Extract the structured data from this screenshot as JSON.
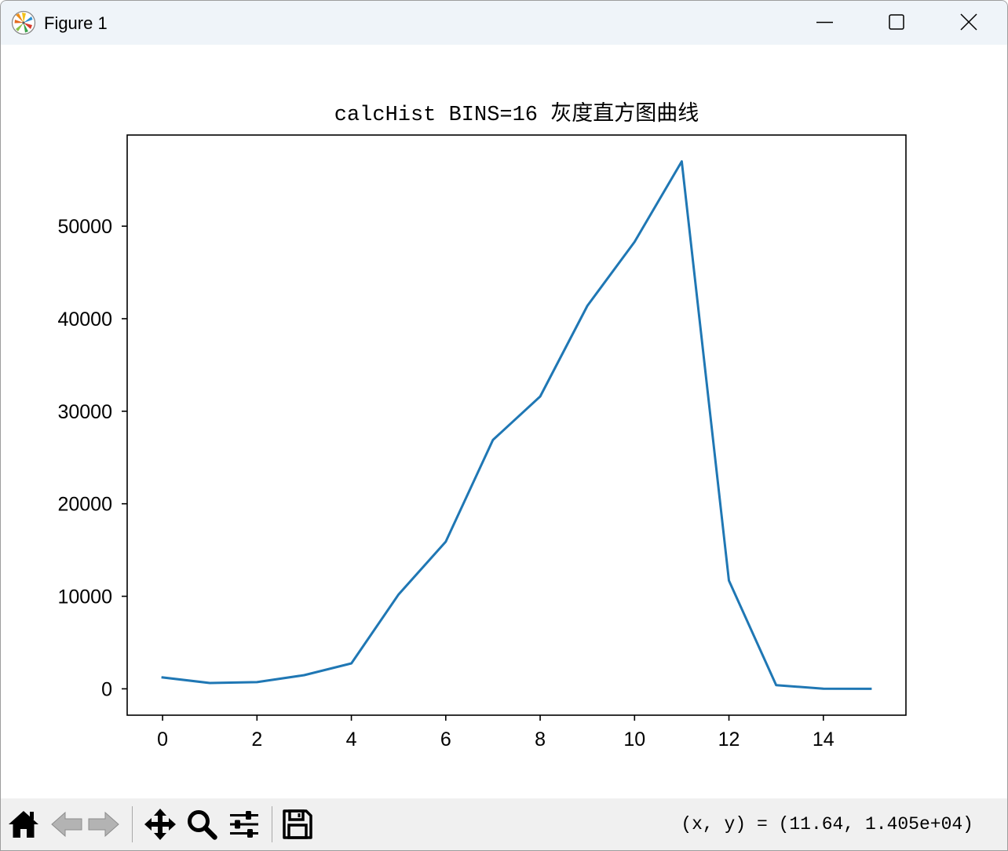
{
  "window": {
    "title": "Figure 1",
    "app_icon": "matplotlib-logo-icon",
    "controls": {
      "minimize": "minimize-icon",
      "maximize": "maximize-icon",
      "close": "close-icon"
    }
  },
  "chart_data": {
    "type": "line",
    "title": "calcHist BINS=16 灰度直方图曲线",
    "x": [
      0,
      1,
      2,
      3,
      4,
      5,
      6,
      7,
      8,
      9,
      10,
      11,
      12,
      13,
      14,
      15
    ],
    "series": [
      {
        "values": [
          1230,
          630,
          720,
          1480,
          2750,
          10200,
          15900,
          26900,
          31600,
          41400,
          48300,
          57000,
          11700,
          400,
          20,
          0
        ],
        "color": "#1f77b4"
      }
    ],
    "xlim": [
      -0.75,
      15.75
    ],
    "ylim": [
      -2850,
      59850
    ],
    "xticks": [
      0,
      2,
      4,
      6,
      8,
      10,
      12,
      14
    ],
    "yticks": [
      0,
      10000,
      20000,
      30000,
      40000,
      50000
    ],
    "grid": false
  },
  "toolbar": {
    "buttons": [
      {
        "icon": "home-icon",
        "enabled": true
      },
      {
        "icon": "back-arrow-icon",
        "enabled": false
      },
      {
        "icon": "forward-arrow-icon",
        "enabled": false
      },
      {
        "icon": "pan-icon",
        "enabled": true
      },
      {
        "icon": "zoom-icon",
        "enabled": true
      },
      {
        "icon": "configure-subplots-icon",
        "enabled": true
      },
      {
        "icon": "save-icon",
        "enabled": true
      }
    ],
    "coordinates": "(x, y) = (11.64, 1.405e+04)"
  }
}
